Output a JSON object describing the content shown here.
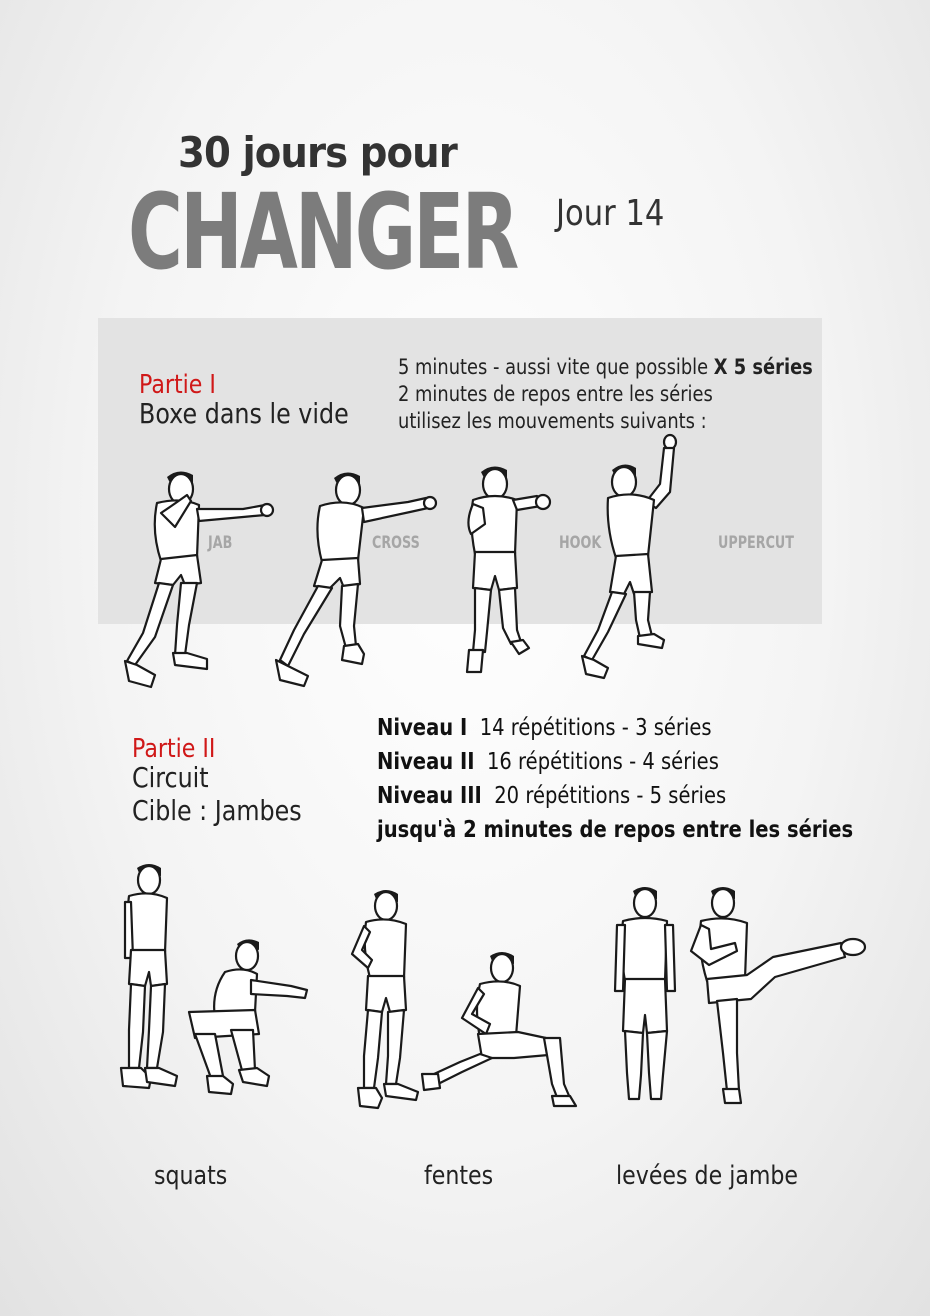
{
  "header": {
    "title_small": "30 jours pour",
    "title_big": "CHANGER",
    "day": "Jour 14"
  },
  "part1": {
    "label": "Partie I",
    "name": "Boxe dans le vide",
    "info": {
      "line1": "5 minutes - aussi vite que possible ",
      "line1_bold": "X 5 séries",
      "line2": "2 minutes de repos entre les séries",
      "line3": "utilisez les mouvements suivants :"
    },
    "moves": [
      "JAB",
      "CROSS",
      "HOOK",
      "UPPERCUT"
    ]
  },
  "part2": {
    "label": "Partie II",
    "name": "Circuit",
    "target": "Cible : Jambes",
    "levels": [
      {
        "level": "Niveau I",
        "detail": "14 répétitions  -  3 séries"
      },
      {
        "level": "Niveau II",
        "detail": "16 répétitions  -  4 séries"
      },
      {
        "level": "Niveau III",
        "detail": "20 répétitions  - 5 séries"
      }
    ],
    "rest": "jusqu'à 2 minutes de repos entre les séries",
    "exercises": [
      "squats",
      "fentes",
      "levées de jambe"
    ]
  }
}
